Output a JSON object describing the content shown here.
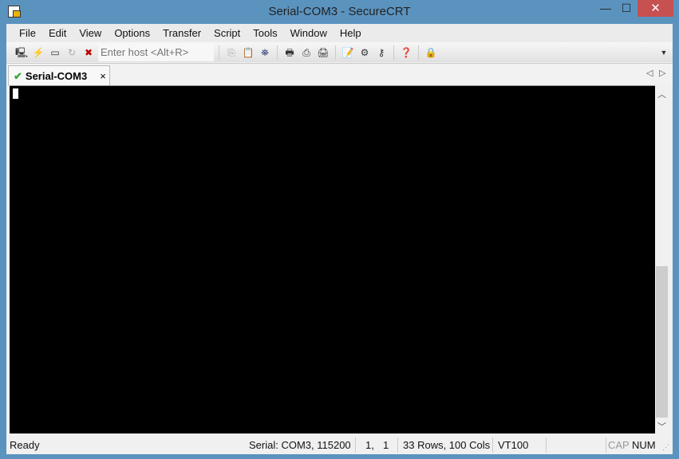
{
  "window": {
    "title": "Serial-COM3 - SecureCRT",
    "minimize": "—",
    "maximize": "☐",
    "close": "✕"
  },
  "menu": [
    "File",
    "Edit",
    "View",
    "Options",
    "Transfer",
    "Script",
    "Tools",
    "Window",
    "Help"
  ],
  "toolbar": {
    "host_placeholder": "Enter host <Alt+R>"
  },
  "tab": {
    "label": "Serial-COM3",
    "close": "×",
    "status_icon": "check-icon"
  },
  "status": {
    "ready": "Ready",
    "connection": "Serial: COM3, 115200",
    "row": "1,",
    "col": "1",
    "size": "33 Rows, 100 Cols",
    "emulation": "VT100",
    "cap": "CAP",
    "num": "NUM"
  }
}
